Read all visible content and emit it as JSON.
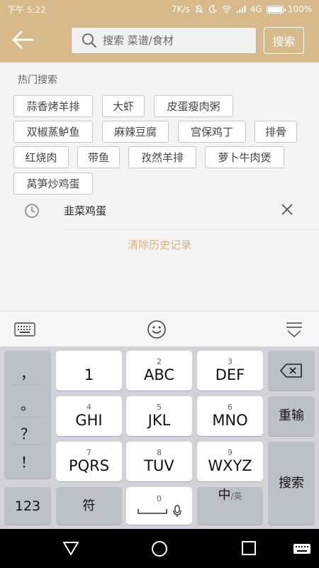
{
  "status_bar": {
    "time": "下午 5:22",
    "network_speed": "7K/s",
    "network_type": "4G",
    "battery": "100%"
  },
  "header": {
    "search_placeholder": "搜索 菜谱/食材",
    "search_button": "搜索"
  },
  "hot_search": {
    "title": "热门搜索",
    "items": [
      "蒜香烤羊排",
      "大虾",
      "皮蛋瘦肉粥",
      "双椒蒸鲈鱼",
      "麻辣豆腐",
      "宫保鸡丁",
      "排骨",
      "红烧肉",
      "带鱼",
      "孜然羊排",
      "萝卜牛肉煲",
      "莴笋炒鸡蛋"
    ]
  },
  "history": {
    "items": [
      "韭菜鸡蛋"
    ],
    "clear_label": "清除历史记录"
  },
  "keyboard": {
    "punctuation": [
      "，",
      "。",
      "？",
      "！"
    ],
    "keys": [
      {
        "main": "1",
        "sub": ""
      },
      {
        "main": "ABC",
        "sub": "2"
      },
      {
        "main": "DEF",
        "sub": "3"
      },
      {
        "main": "GHI",
        "sub": "4"
      },
      {
        "main": "JKL",
        "sub": "5"
      },
      {
        "main": "MNO",
        "sub": "6"
      },
      {
        "main": "PQRS",
        "sub": "7"
      },
      {
        "main": "TUV",
        "sub": "8"
      },
      {
        "main": "WXYZ",
        "sub": "9"
      }
    ],
    "reinput": "重输",
    "search": "搜索",
    "num_toggle": "123",
    "symbol": "符",
    "space_sub": "0",
    "lang_main": "中",
    "lang_sub": "/英"
  },
  "colors": {
    "brand": "#d7b98a",
    "accent_text": "#d6b57f"
  }
}
